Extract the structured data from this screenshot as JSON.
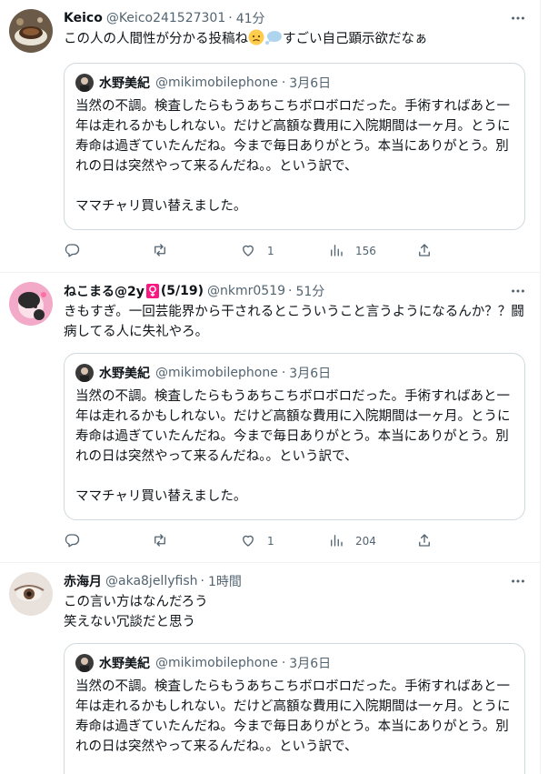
{
  "quoted": {
    "name": "水野美紀",
    "handle": "@mikimobilephone",
    "sep": "·",
    "date": "3月6日",
    "paragraph1": "当然の不調。検査したらもうあちこちボロボロだった。手術すればあと一年は走れるかもしれない。だけど高額な費用に入院期間は一ヶ月。とうに寿命は過ぎていたんだね。今まで毎日ありがとう。本当にありがとう。別れの日は突然やって来るんだね。。という訳で、",
    "paragraph2": "ママチャリ買い替えました。"
  },
  "tweets": [
    {
      "name": "Keico",
      "handle": "@Keico241527301",
      "sep": "·",
      "time": "41分",
      "text_a": "この人の人間性が分かる投稿ね",
      "text_b": "すごい自己顕示欲だなぁ",
      "likes": "1",
      "views": "156"
    },
    {
      "name": "ねこまる@2y",
      "name_b": "(5/19)",
      "handle": "@nkmr0519",
      "sep": "·",
      "time": "51分",
      "text": "きもすぎ。一回芸能界から干されるとこういうこと言うようになるんか？？闘病してる人に失礼やろ。",
      "likes": "1",
      "views": "204"
    },
    {
      "name": "赤海月",
      "handle": "@aka8jellyfish",
      "sep": "·",
      "time": "1時間",
      "line1": "この言い方はなんだろう",
      "line2": "笑えない冗談だと思う"
    }
  ],
  "icons": {
    "reply": "reply-icon",
    "retweet": "retweet-icon",
    "like": "heart-icon",
    "views": "analytics-icon",
    "share": "share-icon",
    "more": "more-icon"
  },
  "colors": {
    "text": "#0f1419",
    "secondary": "#536471",
    "border": "#cfd9de",
    "divider": "#eff3f4",
    "female_sign": "#f91880"
  }
}
